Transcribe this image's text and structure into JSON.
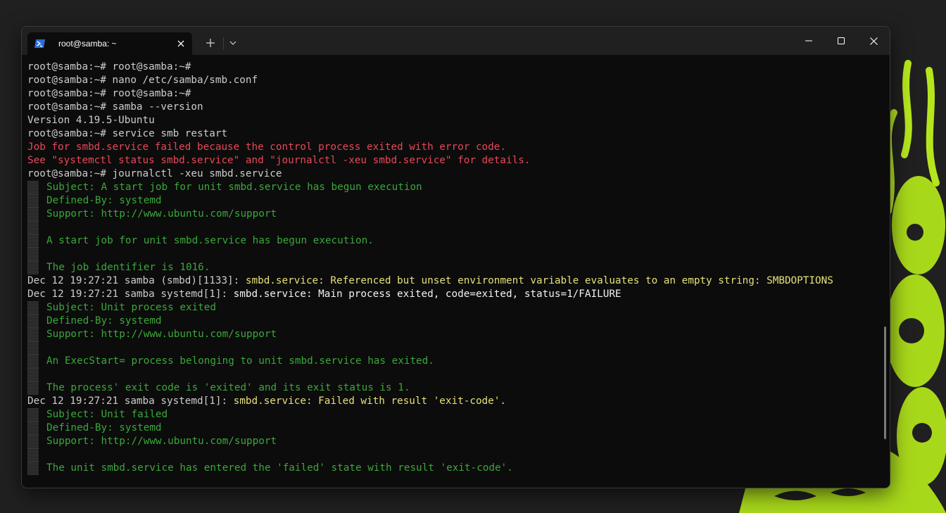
{
  "window": {
    "tab_title": "root@samba: ~",
    "icons": {
      "tab": "powershell-icon",
      "close_tab": "close-icon",
      "new_tab": "plus-icon",
      "dropdown": "chevron-down-icon",
      "minimize": "minimize-icon",
      "maximize": "maximize-icon",
      "close": "close-icon"
    }
  },
  "colors": {
    "terminal_bg": "#0c0c0c",
    "titlebar_bg": "#202020",
    "error_red": "#e74856",
    "journal_green": "#3aa83a",
    "highlight_yellow": "#e5e07a",
    "wallpaper_accent": "#b5e61d"
  },
  "terminal": {
    "lines": [
      {
        "gutter": false,
        "parts": [
          {
            "c": "plain",
            "t": "root@samba:~# root@samba:~#"
          }
        ]
      },
      {
        "gutter": false,
        "parts": [
          {
            "c": "plain",
            "t": "root@samba:~# nano /etc/samba/smb.conf"
          }
        ]
      },
      {
        "gutter": false,
        "parts": [
          {
            "c": "plain",
            "t": "root@samba:~# root@samba:~#"
          }
        ]
      },
      {
        "gutter": false,
        "parts": [
          {
            "c": "plain",
            "t": "root@samba:~# samba --version"
          }
        ]
      },
      {
        "gutter": false,
        "parts": [
          {
            "c": "plain",
            "t": "Version 4.19.5-Ubuntu"
          }
        ]
      },
      {
        "gutter": false,
        "parts": [
          {
            "c": "plain",
            "t": "root@samba:~# service smb restart"
          }
        ]
      },
      {
        "gutter": false,
        "parts": [
          {
            "c": "red",
            "t": "Job for smbd.service failed because the control process exited with error code."
          }
        ]
      },
      {
        "gutter": false,
        "parts": [
          {
            "c": "red",
            "t": "See \"systemctl status smbd.service\" and \"journalctl -xeu smbd.service\" for details."
          }
        ]
      },
      {
        "gutter": false,
        "parts": [
          {
            "c": "plain",
            "t": "root@samba:~# journalctl -xeu smbd.service"
          }
        ]
      },
      {
        "gutter": true,
        "parts": [
          {
            "c": "g",
            "t": "Subject: A start job for unit smbd.service has begun execution"
          }
        ]
      },
      {
        "gutter": true,
        "parts": [
          {
            "c": "g",
            "t": "Defined-By: systemd"
          }
        ]
      },
      {
        "gutter": true,
        "parts": [
          {
            "c": "g",
            "t": "Support: http://www.ubuntu.com/support"
          }
        ]
      },
      {
        "gutter": true,
        "parts": [
          {
            "c": "g",
            "t": ""
          }
        ]
      },
      {
        "gutter": true,
        "parts": [
          {
            "c": "g",
            "t": "A start job for unit smbd.service has begun execution."
          }
        ]
      },
      {
        "gutter": true,
        "parts": [
          {
            "c": "g",
            "t": ""
          }
        ]
      },
      {
        "gutter": true,
        "parts": [
          {
            "c": "g",
            "t": "The job identifier is 1016."
          }
        ]
      },
      {
        "gutter": false,
        "parts": [
          {
            "c": "plain",
            "t": "Dec 12 19:27:21 samba (smbd)[1133]: "
          },
          {
            "c": "yellow",
            "t": "smbd.service: Referenced but unset environment variable evaluates to an empty string: SMBDOPTIONS"
          }
        ]
      },
      {
        "gutter": false,
        "parts": [
          {
            "c": "plain",
            "t": "Dec 12 19:27:21 samba systemd[1]: "
          },
          {
            "c": "white",
            "t": "smbd.service: Main process exited, code=exited, status=1/FAILURE"
          }
        ]
      },
      {
        "gutter": true,
        "parts": [
          {
            "c": "g",
            "t": "Subject: Unit process exited"
          }
        ]
      },
      {
        "gutter": true,
        "parts": [
          {
            "c": "g",
            "t": "Defined-By: systemd"
          }
        ]
      },
      {
        "gutter": true,
        "parts": [
          {
            "c": "g",
            "t": "Support: http://www.ubuntu.com/support"
          }
        ]
      },
      {
        "gutter": true,
        "parts": [
          {
            "c": "g",
            "t": ""
          }
        ]
      },
      {
        "gutter": true,
        "parts": [
          {
            "c": "g",
            "t": "An ExecStart= process belonging to unit smbd.service has exited."
          }
        ]
      },
      {
        "gutter": true,
        "parts": [
          {
            "c": "g",
            "t": ""
          }
        ]
      },
      {
        "gutter": true,
        "parts": [
          {
            "c": "g",
            "t": "The process' exit code is 'exited' and its exit status is 1."
          }
        ]
      },
      {
        "gutter": false,
        "parts": [
          {
            "c": "plain",
            "t": "Dec 12 19:27:21 samba systemd[1]: "
          },
          {
            "c": "yellow",
            "t": "smbd.service: Failed with result 'exit-code'."
          }
        ]
      },
      {
        "gutter": true,
        "parts": [
          {
            "c": "g",
            "t": "Subject: Unit failed"
          }
        ]
      },
      {
        "gutter": true,
        "parts": [
          {
            "c": "g",
            "t": "Defined-By: systemd"
          }
        ]
      },
      {
        "gutter": true,
        "parts": [
          {
            "c": "g",
            "t": "Support: http://www.ubuntu.com/support"
          }
        ]
      },
      {
        "gutter": true,
        "parts": [
          {
            "c": "g",
            "t": ""
          }
        ]
      },
      {
        "gutter": true,
        "parts": [
          {
            "c": "g",
            "t": "The unit smbd.service has entered the 'failed' state with result 'exit-code'."
          }
        ]
      }
    ]
  }
}
